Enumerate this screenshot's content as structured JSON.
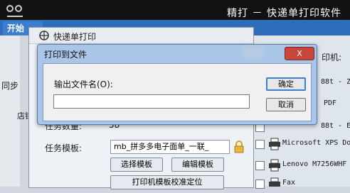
{
  "app": {
    "title": "精打 － 快递单打印软件",
    "start_tab": "开始"
  },
  "express_window": {
    "title": "快递单打印"
  },
  "left_panel": {
    "label_sync": "同步",
    "label_store": "店铺"
  },
  "form": {
    "task_count_label": "任务数量:",
    "task_count_value": "58",
    "task_template_label": "任务模板:",
    "task_template_value": "mb_拼多多电子面单_一联_",
    "select_template_button": "选择模板",
    "edit_template_button": "编辑模板",
    "calibrate_button": "打印机模板校准定位"
  },
  "printer_panel": {
    "header_fragment": "印机:",
    "printers": [
      {
        "name": "88t - Z",
        "checked": false
      },
      {
        "name": "PDF",
        "checked": false
      },
      {
        "name": "88t - E",
        "checked": false
      },
      {
        "name": "Microsoft XPS Do",
        "checked": false
      },
      {
        "name": "Lenovo M7256WHF",
        "checked": false
      },
      {
        "name": "Fax",
        "checked": false
      }
    ]
  },
  "dialog": {
    "title": "打印到文件",
    "close_label": "X",
    "field_label": "输出文件名(O):",
    "field_value": "",
    "ok_button": "确定",
    "cancel_button": "取消"
  }
}
